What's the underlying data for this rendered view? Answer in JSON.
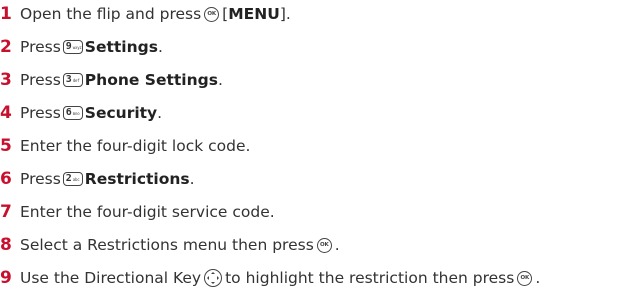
{
  "colors": {
    "step_number": "#c8102e",
    "text": "#333333"
  },
  "steps": [
    {
      "number": "1",
      "text_a": "Open the flip and press",
      "text_b": "[",
      "bold": "MENU",
      "text_c": "]."
    },
    {
      "number": "2",
      "text_a": "Press",
      "key_digit": "9",
      "key_letters": "wxyz",
      "bold": "Settings",
      "text_c": "."
    },
    {
      "number": "3",
      "text_a": "Press",
      "key_digit": "3",
      "key_letters": "def",
      "bold": "Phone Settings",
      "text_c": "."
    },
    {
      "number": "4",
      "text_a": "Press",
      "key_digit": "6",
      "key_letters": "mno",
      "bold": "Security",
      "text_c": "."
    },
    {
      "number": "5",
      "text_a": "Enter the four-digit lock code."
    },
    {
      "number": "6",
      "text_a": "Press",
      "key_digit": "2",
      "key_letters": "abc",
      "bold": "Restrictions",
      "text_c": "."
    },
    {
      "number": "7",
      "text_a": "Enter the four-digit service code."
    },
    {
      "number": "8",
      "text_a": "Select a Restrictions menu then press",
      "text_c": "."
    },
    {
      "number": "9",
      "text_a": "Use the Directional Key",
      "text_b": "to highlight the restriction then press",
      "text_c": "."
    }
  ]
}
